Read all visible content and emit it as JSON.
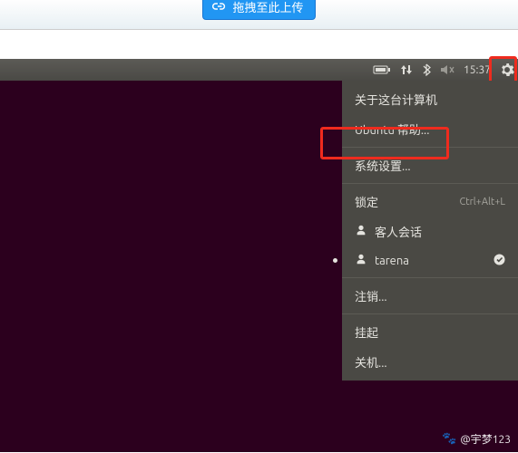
{
  "banner": {
    "upload_label": "拖拽至此上传"
  },
  "menubar": {
    "time": "15:37"
  },
  "menu": {
    "about": "关于这台计算机",
    "help": "Ubuntu 帮助...",
    "settings": "系统设置...",
    "lock": "锁定",
    "lock_shortcut": "Ctrl+Alt+L",
    "guest": "客人会话",
    "user": "tarena",
    "logout": "注销...",
    "suspend": "挂起",
    "shutdown": "关机..."
  },
  "watermark": {
    "text": "@宇梦123"
  }
}
